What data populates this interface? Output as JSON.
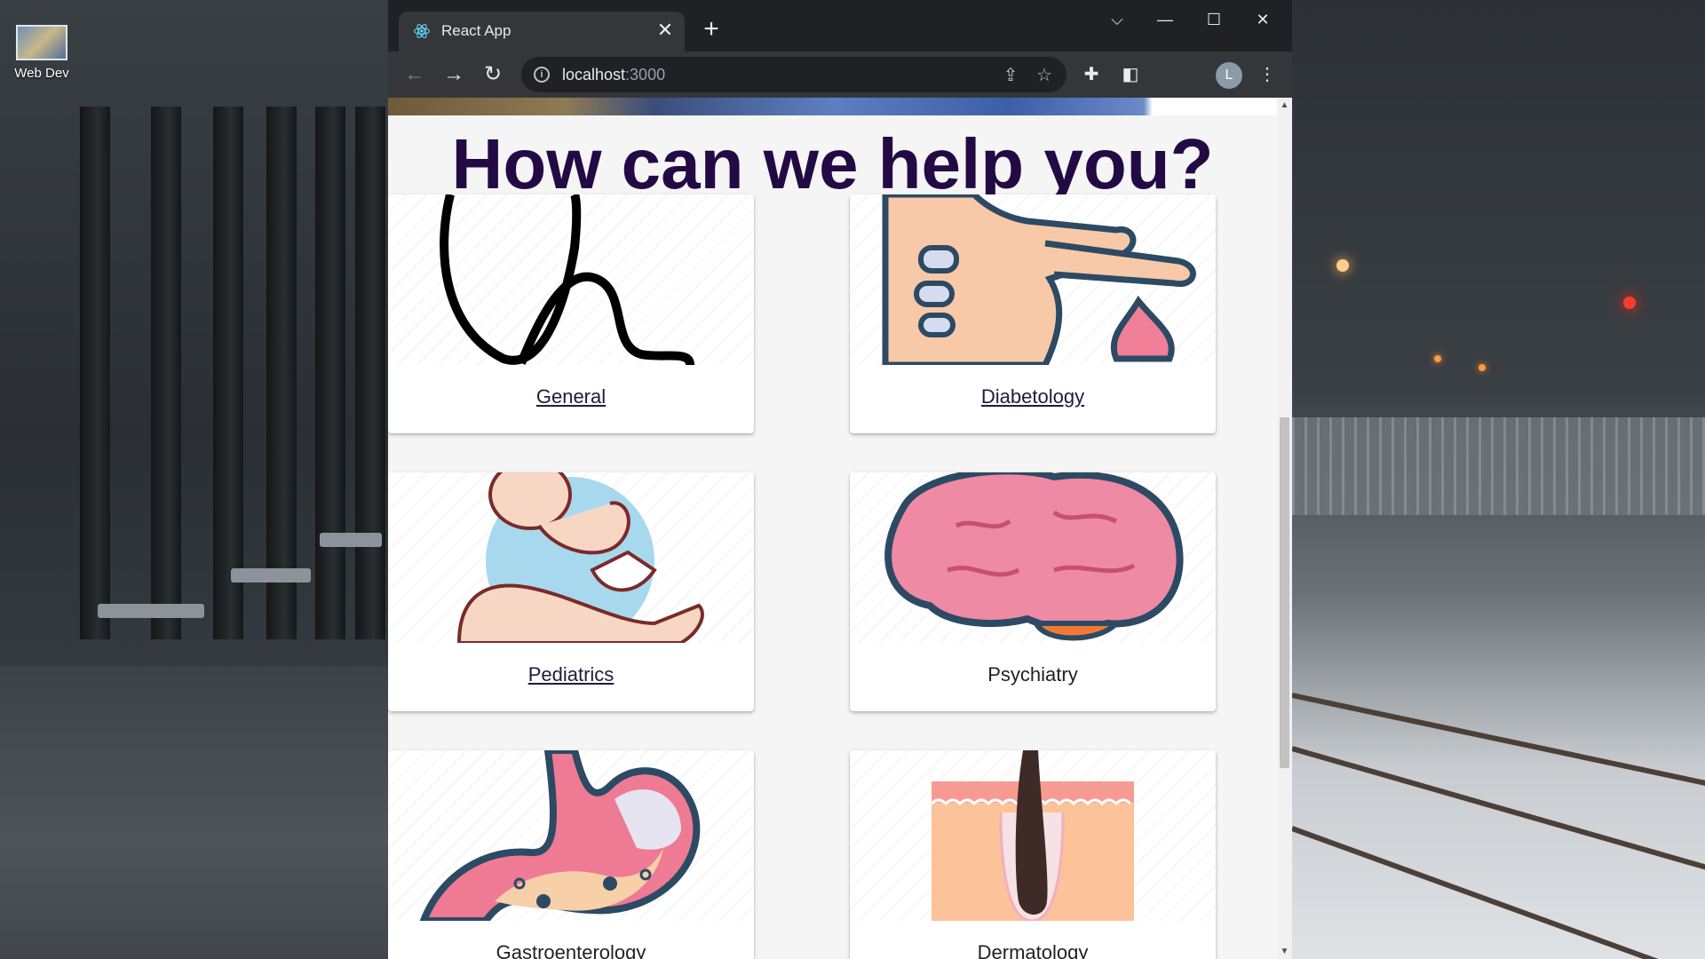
{
  "desktop": {
    "icons": [
      {
        "label": "Web Dev",
        "icon": "folder-thumbnail-icon"
      }
    ]
  },
  "browser": {
    "tab": {
      "title": "React App",
      "favicon": "react-logo-icon",
      "close_glyph": "✕"
    },
    "new_tab_glyph": "+",
    "window_controls": {
      "tab_search": "⌵",
      "minimize": "—",
      "maximize": "☐",
      "close": "✕"
    },
    "nav": {
      "back": "←",
      "forward": "→",
      "reload": "↻"
    },
    "address": {
      "host": "localhost",
      "port": ":3000",
      "info_glyph": "i"
    },
    "toolbar_icons": {
      "share": "⇪",
      "bookmark": "☆",
      "extensions": "✚",
      "sidepanel": "◧",
      "menu": "⋮"
    },
    "profile_initial": "L"
  },
  "page": {
    "heading": "How can we help you?",
    "cards": [
      {
        "label": "General",
        "illustration": "stethoscope-icon",
        "linked": true
      },
      {
        "label": "Diabetology",
        "illustration": "finger-blood-drop-icon",
        "linked": true
      },
      {
        "label": "Pediatrics",
        "illustration": "baby-in-hand-icon",
        "linked": true
      },
      {
        "label": "Psychiatry",
        "illustration": "brain-icon",
        "linked": false
      },
      {
        "label": "Gastroenterology",
        "illustration": "stomach-icon",
        "linked": false
      },
      {
        "label": "Dermatology",
        "illustration": "skin-hair-follicle-icon",
        "linked": false
      }
    ]
  },
  "colors": {
    "heading": "#230a45",
    "browser_frame": "#202124",
    "toolbar": "#35363a"
  }
}
